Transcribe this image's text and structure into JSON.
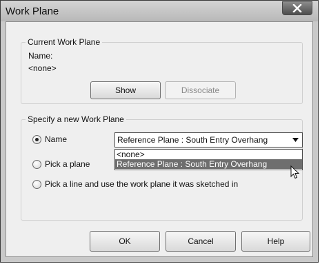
{
  "window": {
    "title": "Work Plane"
  },
  "current_group": {
    "legend": "Current Work Plane",
    "name_label": "Name:",
    "name_value": "<none>",
    "show_label": "Show",
    "dissociate_label": "Dissociate"
  },
  "new_group": {
    "legend": "Specify a new Work Plane",
    "options": [
      {
        "label": "Name",
        "checked": true
      },
      {
        "label": "Pick a plane",
        "checked": false
      },
      {
        "label": "Pick a line and use the work plane it was sketched in",
        "checked": false
      }
    ],
    "name_combo": {
      "selected": "Reference Plane : South Entry Overhang",
      "items": [
        "<none>",
        "Reference Plane : South Entry Overhang"
      ],
      "highlighted_index": 1
    }
  },
  "footer": {
    "ok_label": "OK",
    "cancel_label": "Cancel",
    "help_label": "Help"
  },
  "icons": {
    "close": "close-icon",
    "dropdown_arrow": "chevron-down-icon",
    "cursor": "mouse-pointer-icon"
  }
}
